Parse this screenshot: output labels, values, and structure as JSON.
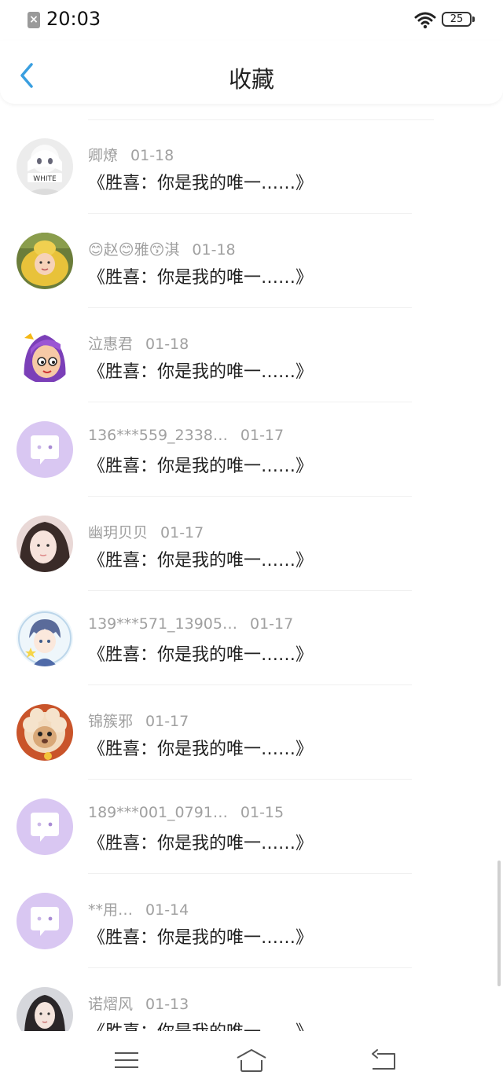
{
  "status_bar": {
    "time": "20:03",
    "battery": "25",
    "sim_icon": "sim-error-icon",
    "wifi_icon": "wifi-icon"
  },
  "header": {
    "title": "收藏",
    "back_icon": "chevron-left-icon"
  },
  "colors": {
    "accent": "#3a9fe0",
    "avatar_default_bg": "#d9c7f2",
    "avatar_default_icon": "#ffffff",
    "meta_text": "#a0a0a0"
  },
  "favorites": [
    {
      "name": "卿燎",
      "date": "01-18",
      "content": "《胜喜：你是我的唯一……》",
      "avatar": "photo-avatar-white-hair-anime"
    },
    {
      "name": "😊赵😊雅😙淇",
      "date": "01-18",
      "content": "《胜喜：你是我的唯一……》",
      "avatar": "photo-avatar-child-yellow"
    },
    {
      "name": "泣惠君",
      "date": "01-18",
      "content": "《胜喜：你是我的唯一……》",
      "avatar": "cartoon-avatar-purple-hair"
    },
    {
      "name": "136***559_2338…",
      "date": "01-17",
      "content": "《胜喜：你是我的唯一……》",
      "avatar": "default-chat-avatar"
    },
    {
      "name": "幽玥贝贝",
      "date": "01-17",
      "content": "《胜喜：你是我的唯一……》",
      "avatar": "photo-avatar-girl"
    },
    {
      "name": "139***571_13905…",
      "date": "01-17",
      "content": "《胜喜：你是我的唯一……》",
      "avatar": "anime-avatar-blue-boy"
    },
    {
      "name": "锦簇邪",
      "date": "01-17",
      "content": "《胜喜：你是我的唯一……》",
      "avatar": "cartoon-avatar-sheep"
    },
    {
      "name": "189***001_0791…",
      "date": "01-15",
      "content": "《胜喜：你是我的唯一……》",
      "avatar": "default-chat-avatar"
    },
    {
      "name": "**用…",
      "date": "01-14",
      "content": "《胜喜：你是我的唯一……》",
      "avatar": "default-chat-avatar"
    },
    {
      "name": "诺熠风",
      "date": "01-13",
      "content": "《胜喜：你是我的唯一……》",
      "avatar": "photo-avatar-woman"
    }
  ],
  "nav_bar": {
    "menu_icon": "menu-icon",
    "home_icon": "home-icon",
    "back_icon": "back-icon"
  }
}
